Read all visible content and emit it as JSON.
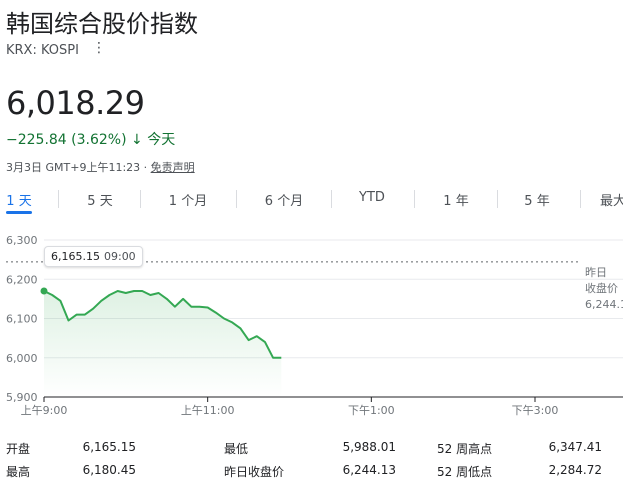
{
  "header": {
    "title": "韩国综合股价指数",
    "ticker": "KRX: KOSPI",
    "menu_icon": "more-vert-icon"
  },
  "quote": {
    "price": "6,018.29",
    "change": "−225.84 (3.62%)",
    "change_arrow": "↓",
    "change_period": "今天",
    "timestamp": "3月3日 GMT+9上午11:23 · ",
    "disclaimer": "免责声明",
    "color_down": "#137333"
  },
  "tabs": [
    {
      "label": "1 天",
      "active": true
    },
    {
      "label": "5 天",
      "active": false
    },
    {
      "label": "1 个月",
      "active": false
    },
    {
      "label": "6 个月",
      "active": false
    },
    {
      "label": "YTD",
      "active": false
    },
    {
      "label": "1 年",
      "active": false
    },
    {
      "label": "5 年",
      "active": false
    },
    {
      "label": "最大",
      "active": false
    }
  ],
  "tooltip": {
    "value": "6,165.15",
    "time": "09:00"
  },
  "chart_data": {
    "type": "area",
    "y_ticks": [
      "6,300",
      "6,200",
      "6,100",
      "6,000",
      "5,900"
    ],
    "ylim": [
      5900,
      6300
    ],
    "x_ticks": [
      "上午9:00",
      "上午11:00",
      "下午1:00",
      "下午3:00"
    ],
    "x_tick_minutes": [
      0,
      120,
      240,
      360
    ],
    "x_range_minutes": [
      0,
      440
    ],
    "previous_close": {
      "label_line1": "昨日",
      "label_line2": "收盘价",
      "value": "6,244.1",
      "y": 6244.13
    },
    "color": "#34a853",
    "series": [
      {
        "points": [
          [
            0,
            6170
          ],
          [
            6,
            6160
          ],
          [
            12,
            6145
          ],
          [
            18,
            6095
          ],
          [
            24,
            6110
          ],
          [
            30,
            6110
          ],
          [
            36,
            6125
          ],
          [
            42,
            6145
          ],
          [
            48,
            6160
          ],
          [
            54,
            6170
          ],
          [
            60,
            6165
          ],
          [
            66,
            6170
          ],
          [
            72,
            6170
          ],
          [
            78,
            6160
          ],
          [
            84,
            6165
          ],
          [
            90,
            6150
          ],
          [
            96,
            6130
          ],
          [
            102,
            6150
          ],
          [
            108,
            6130
          ],
          [
            114,
            6130
          ],
          [
            120,
            6128
          ],
          [
            126,
            6115
          ],
          [
            132,
            6100
          ],
          [
            138,
            6090
          ],
          [
            144,
            6075
          ],
          [
            150,
            6045
          ],
          [
            156,
            6055
          ],
          [
            162,
            6040
          ],
          [
            168,
            6000
          ],
          [
            174,
            6000
          ]
        ]
      }
    ]
  },
  "stats": [
    {
      "label": "开盘",
      "value": "6,165.15"
    },
    {
      "label": "最低",
      "value": "5,988.01"
    },
    {
      "label": "52 周高点",
      "value": "6,347.41"
    },
    {
      "label": "最高",
      "value": "6,180.45"
    },
    {
      "label": "昨日收盘价",
      "value": "6,244.13"
    },
    {
      "label": "52 周低点",
      "value": "2,284.72"
    }
  ]
}
